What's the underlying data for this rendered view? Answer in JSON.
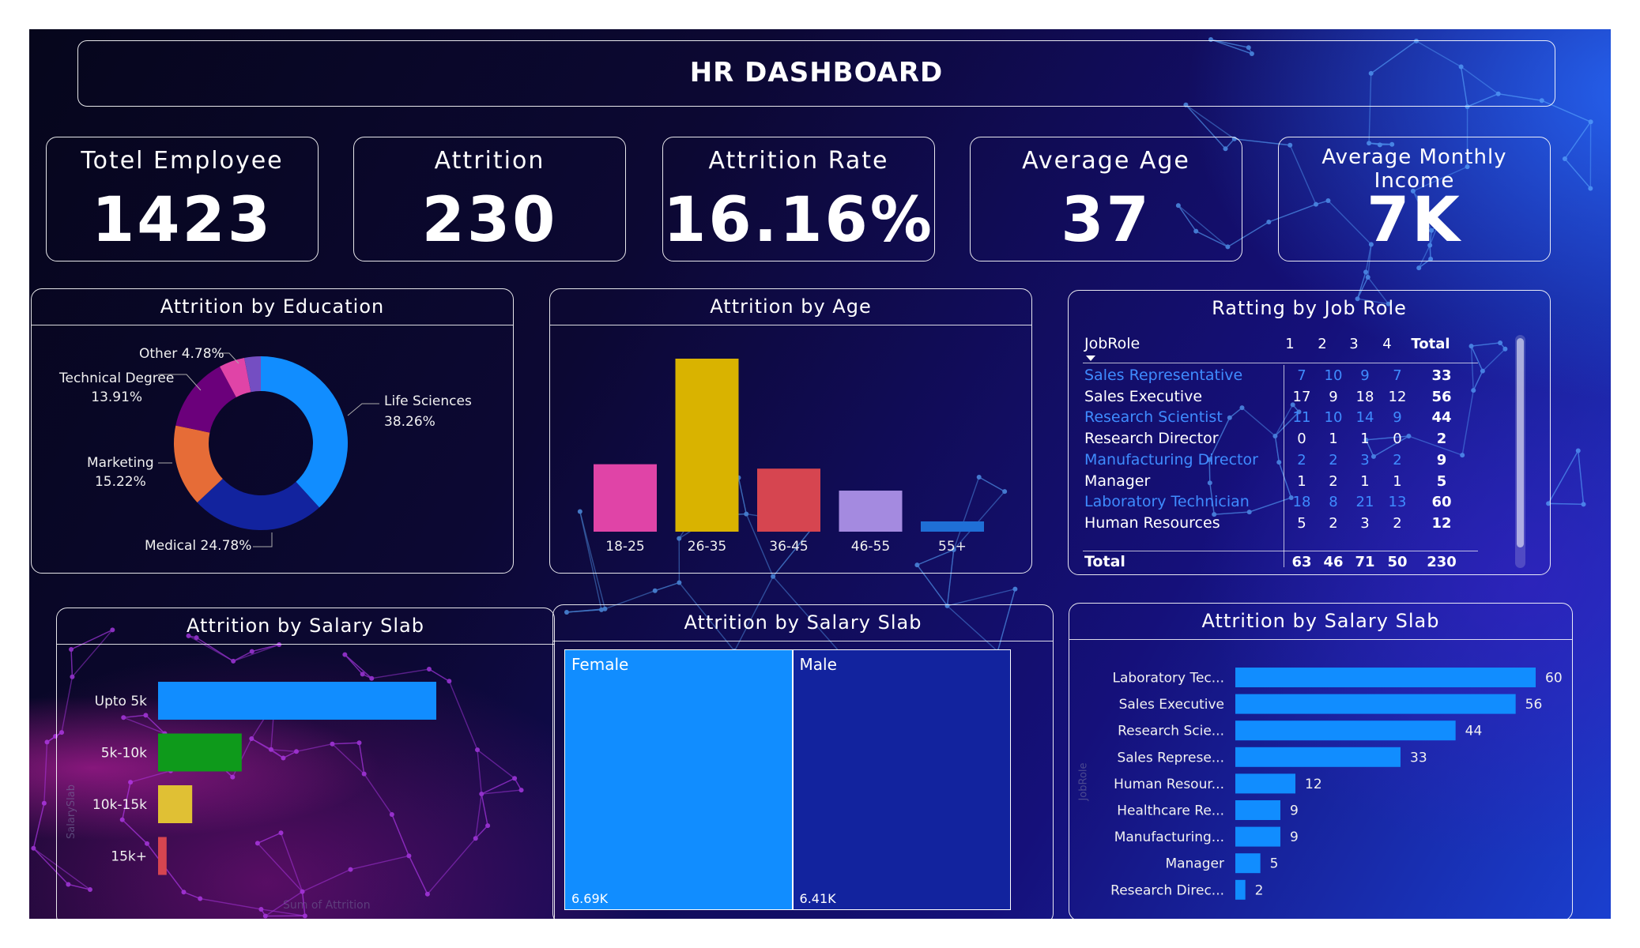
{
  "header": {
    "title": "HR DASHBOARD"
  },
  "kpis": [
    {
      "label": "Totel Employee",
      "value": "1423"
    },
    {
      "label": "Attrition",
      "value": "230"
    },
    {
      "label": "Attrition Rate",
      "value": "16.16%"
    },
    {
      "label": "Average Age",
      "value": "37"
    },
    {
      "label": "Average Monthly Income",
      "value": "7K"
    }
  ],
  "education_chart": {
    "title": "Attrition by Education",
    "slices": [
      {
        "name": "Life Sciences",
        "value": 38.26,
        "pct": "38.26%",
        "color": "#118dff"
      },
      {
        "name": "Medical",
        "value": 24.78,
        "pct": "24.78%",
        "color": "#12239e"
      },
      {
        "name": "Marketing",
        "value": 15.22,
        "pct": "15.22%",
        "color": "#e66c37"
      },
      {
        "name": "Technical Degree",
        "value": 13.91,
        "pct": "13.91%",
        "color": "#6b007b"
      },
      {
        "name": "Other",
        "value": 4.78,
        "pct": "4.78%",
        "color": "#e044a7"
      },
      {
        "name": "",
        "value": 3.05,
        "pct": "",
        "color": "#744ec2"
      }
    ]
  },
  "age_chart": {
    "title": "Attrition by Age",
    "bars": [
      {
        "category": "18-25",
        "value": 46,
        "color": "#e044a7"
      },
      {
        "category": "26-35",
        "value": 118,
        "color": "#d9b300"
      },
      {
        "category": "36-45",
        "value": 43,
        "color": "#d64550"
      },
      {
        "category": "46-55",
        "value": 28,
        "color": "#a48ae0"
      },
      {
        "category": "55+",
        "value": 7,
        "color": "#1f6fd6"
      }
    ],
    "ymax": 118
  },
  "job_matrix": {
    "title": "Ratting by Job Role",
    "headers": [
      "JobRole",
      "1",
      "2",
      "3",
      "4",
      "Total"
    ],
    "rows": [
      {
        "role": "Sales Representative",
        "v": [
          "7",
          "10",
          "9",
          "7"
        ],
        "total": "33",
        "link": true
      },
      {
        "role": "Sales Executive",
        "v": [
          "17",
          "9",
          "18",
          "12"
        ],
        "total": "56",
        "link": false
      },
      {
        "role": "Research Scientist",
        "v": [
          "11",
          "10",
          "14",
          "9"
        ],
        "total": "44",
        "link": true
      },
      {
        "role": "Research Director",
        "v": [
          "0",
          "1",
          "1",
          "0"
        ],
        "total": "2",
        "link": false
      },
      {
        "role": "Manufacturing Director",
        "v": [
          "2",
          "2",
          "3",
          "2"
        ],
        "total": "9",
        "link": true
      },
      {
        "role": "Manager",
        "v": [
          "1",
          "2",
          "1",
          "1"
        ],
        "total": "5",
        "link": false
      },
      {
        "role": "Laboratory Technician",
        "v": [
          "18",
          "8",
          "21",
          "13"
        ],
        "total": "60",
        "link": true
      },
      {
        "role": "Human Resources",
        "v": [
          "5",
          "2",
          "3",
          "2"
        ],
        "total": "12",
        "link": false
      }
    ],
    "total_row": {
      "label": "Total",
      "v": [
        "63",
        "46",
        "71",
        "50"
      ],
      "total": "230"
    }
  },
  "salary_chart": {
    "title": "Attrition by Salary Slab",
    "bars": [
      {
        "category": "Upto 5k",
        "value": 163,
        "color": "#118dff"
      },
      {
        "category": "5k-10k",
        "value": 49,
        "color": "#0e9a1b"
      },
      {
        "category": "10k-15k",
        "value": 20,
        "color": "#e0c034"
      },
      {
        "category": "15k+",
        "value": 5,
        "color": "#d64550"
      }
    ],
    "xlabel": "Sum of Attrition",
    "ylabel": "SalarySlab",
    "xmax": 163
  },
  "gender_chart": {
    "title": "Attrition by Salary Slab",
    "tiles": [
      {
        "name": "Female",
        "label": "6.69K",
        "value": 6690,
        "color": "#118dff"
      },
      {
        "name": "Male",
        "label": "6.41K",
        "value": 6410,
        "color": "#12239e"
      }
    ]
  },
  "role_chart": {
    "title": "Attrition by Salary Slab",
    "ylabel": "JobRole",
    "bars": [
      {
        "category": "Laboratory Tec...",
        "value": 60
      },
      {
        "category": "Sales Executive",
        "value": 56
      },
      {
        "category": "Research Scie...",
        "value": 44
      },
      {
        "category": "Sales Represe...",
        "value": 33
      },
      {
        "category": "Human Resour...",
        "value": 12
      },
      {
        "category": "Healthcare Re...",
        "value": 9
      },
      {
        "category": "Manufacturing...",
        "value": 9
      },
      {
        "category": "Manager",
        "value": 5
      },
      {
        "category": "Research Direc...",
        "value": 2
      }
    ],
    "color": "#118dff",
    "xmax": 60
  }
}
